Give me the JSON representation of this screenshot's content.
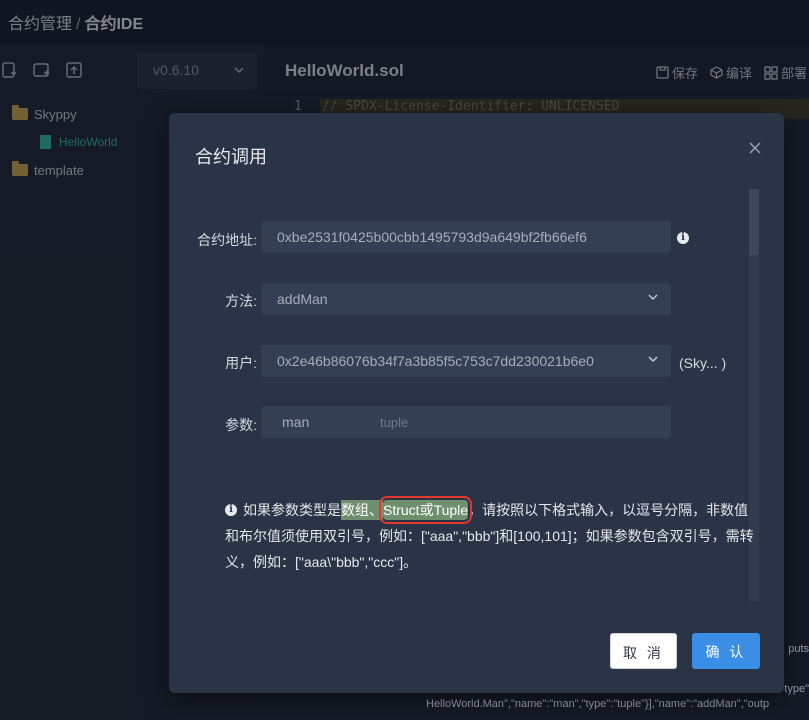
{
  "topbar": {
    "breadcrumb_parent": "合约管理",
    "separator": "/",
    "breadcrumb_current": "合约IDE"
  },
  "sidebar": {
    "version": "v0.6.10",
    "tree": [
      {
        "label": "Skyppy",
        "type": "folder"
      },
      {
        "label": "HelloWorld",
        "type": "file"
      },
      {
        "label": "template",
        "type": "folder"
      }
    ]
  },
  "editor": {
    "file_title": "HelloWorld.sol",
    "actions": {
      "save": "保存",
      "compile": "编译",
      "deploy": "部署"
    },
    "line_number": "1",
    "line_text": "// SPDX-License-Identifier: UNLICENSED",
    "right_snippet_1": "puts",
    "right_snippet_2": "\"type\"",
    "bottom_snippet": "HelloWorld.Man\",\"name\":\"man\",\"type\":\"tuple\"}],\"name\":\"addMan\",\"outp"
  },
  "modal": {
    "title": "合约调用",
    "close_icon": "×",
    "fields": {
      "address_label": "合约地址:",
      "address_value": "0xbe2531f0425b00cbb1495793d9a649bf2fb66ef6",
      "method_label": "方法:",
      "method_value": "addMan",
      "user_label": "用户:",
      "user_value": "0x2e46b86076b34f7a3b85f5c753c7dd230021b6e0",
      "user_suffix": "(Sky... )",
      "params_label": "参数:",
      "param_name": "man",
      "param_type": "tuple"
    },
    "note": {
      "prefix": "如果参数类型是",
      "highlight_1": "数组、",
      "highlight_2": "Struct或Tuple",
      "suffix": "，请按照以下格式输入，以逗号分隔，非数值和布尔值须使用双引号，例如：[\"aaa\",\"bbb\"]和[100,101]；如果参数包含双引号，需转义，例如：[\"aaa\\\"bbb\",\"ccc\"]。"
    },
    "buttons": {
      "cancel": "取 消",
      "ok": "确 认"
    }
  },
  "colors": {
    "accent": "#3a8ee6",
    "highlight": "#6f8f6f",
    "annotation_box": "#e0392d"
  }
}
